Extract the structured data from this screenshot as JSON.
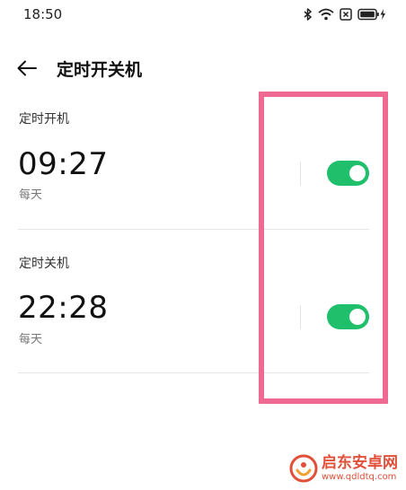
{
  "status_bar": {
    "time": "18:50",
    "icons": [
      "bluetooth-icon",
      "wifi-icon",
      "sim-icon",
      "battery-charging-icon"
    ]
  },
  "header": {
    "back_icon": "arrow-left-icon",
    "title": "定时开关机"
  },
  "schedules": [
    {
      "label": "定时开机",
      "time": "09:27",
      "repeat": "每天",
      "enabled": true
    },
    {
      "label": "定时关机",
      "time": "22:28",
      "repeat": "每天",
      "enabled": true
    }
  ],
  "colors": {
    "toggle_on": "#1fbf6b",
    "highlight": "#ee6a92",
    "watermark": "#e0503a"
  },
  "watermark": {
    "title": "启东安卓网",
    "url": "www.qdldtq.com"
  }
}
